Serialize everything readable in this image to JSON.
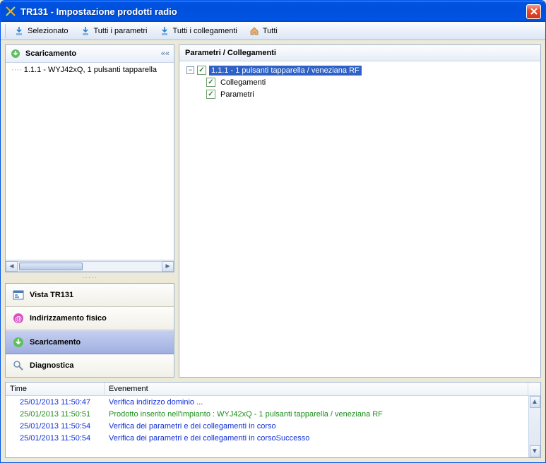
{
  "window": {
    "title": "TR131  -  Impostazione prodotti radio"
  },
  "toolbar": {
    "selected": "Selezionato",
    "all_params": "Tutti i parametri",
    "all_links": "Tutti i collegamenti",
    "all": "Tutti"
  },
  "left": {
    "download_title": "Scaricamento",
    "tree_item": "1.1.1 - WYJ42xQ, 1 pulsanti tapparella"
  },
  "nav": {
    "vista": "Vista TR131",
    "indirizzamento": "Indirizzamento fisico",
    "scaricamento": "Scaricamento",
    "diagnostica": "Diagnostica"
  },
  "right": {
    "header": "Parametri / Collegamenti",
    "node_root": "1.1.1 - 1 pulsanti tapparella / veneziana RF",
    "node_links": "Collegamenti",
    "node_params": "Parametri"
  },
  "log": {
    "col_time": "Time",
    "col_event": "Evenement",
    "rows": [
      {
        "time": "25/01/2013 11:50:47",
        "event": "Verifica indirizzo dominio ...",
        "color": "blue"
      },
      {
        "time": "25/01/2013 11:50:51",
        "event": "Prodotto inserito nell'impianto : WYJ42xQ - 1 pulsanti tapparella / veneziana RF",
        "color": "green"
      },
      {
        "time": "25/01/2013 11:50:54",
        "event": "Verifica dei parametri e dei collegamenti in corso",
        "color": "blue"
      },
      {
        "time": "25/01/2013 11:50:54",
        "event": "Verifica dei parametri e dei collegamenti in corsoSuccesso",
        "color": "blue"
      }
    ]
  }
}
